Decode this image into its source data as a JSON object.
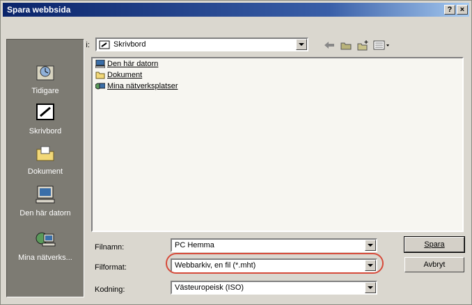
{
  "window": {
    "title": "Spara webbsida",
    "help_label": "?",
    "close_label": "×"
  },
  "toolbar": {
    "save_in_label": "Spara i:",
    "location_value": "Skrivbord",
    "back_icon": "back-arrow-icon",
    "up_icon": "up-folder-icon",
    "new_folder_icon": "new-folder-icon",
    "views_icon": "views-menu-icon"
  },
  "places": [
    {
      "label": "Tidigare",
      "icon": "history-icon"
    },
    {
      "label": "Skrivbord",
      "icon": "desktop-icon"
    },
    {
      "label": "Dokument",
      "icon": "documents-folder-icon"
    },
    {
      "label": "Den här datorn",
      "icon": "my-computer-icon"
    },
    {
      "label": "Mina nätverks...",
      "icon": "network-places-icon"
    }
  ],
  "files": [
    {
      "name": "Den här datorn",
      "icon": "my-computer-icon"
    },
    {
      "name": "Dokument",
      "icon": "folder-icon"
    },
    {
      "name": "Mina nätverksplatser",
      "icon": "network-places-icon"
    }
  ],
  "form": {
    "filename_label": "Filnamn:",
    "filename_value": "PC Hemma",
    "format_label": "Filformat:",
    "format_value": "Webbarkiv, en fil (*.mht)",
    "encoding_label": "Kodning:",
    "encoding_value": "Västeuropeisk (ISO)"
  },
  "buttons": {
    "save": "Spara",
    "cancel": "Avbryt"
  },
  "colors": {
    "title_bar": "#0a246a",
    "highlight_ring": "#d64a3a",
    "places_bar": "#7d7b73"
  }
}
